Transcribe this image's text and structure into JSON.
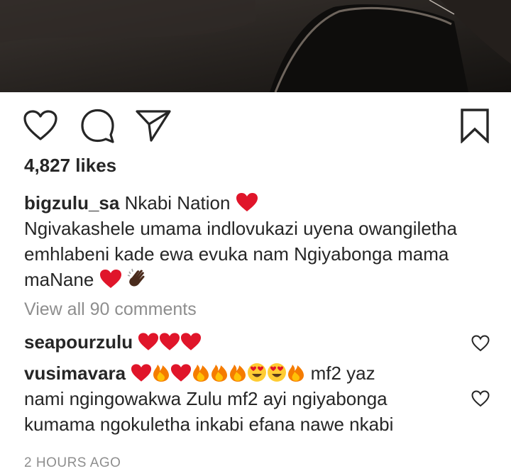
{
  "post": {
    "likes": "4,827 likes",
    "caption_user": "bigzulu_sa",
    "caption_first": "Nkabi Nation",
    "caption_body": "Ngivakashele umama indlovukazi uyena owangiletha emhlabeni kade ewa evuka nam Ngiyabonga mama maNane",
    "view_all": "View all 90 comments",
    "time": "2 HOURS AGO"
  },
  "comments": [
    {
      "user": "seapourzulu",
      "text": ""
    },
    {
      "user": "vusimavara",
      "text_suffix": "mf2 yaz",
      "text_rest": "nami ngingowakwa Zulu mf2 ayi ngiyabonga kumama ngokuletha inkabi efana nawe nkabi"
    }
  ],
  "icons": {
    "like": "heart-outline-icon",
    "comment": "comment-bubble-icon",
    "share": "paper-plane-icon",
    "save": "bookmark-icon",
    "comment_like": "heart-small-icon"
  },
  "colors": {
    "text": "#262626",
    "muted": "#8e8e8e",
    "heart": "#e0152a",
    "fire": "#f57c00"
  }
}
